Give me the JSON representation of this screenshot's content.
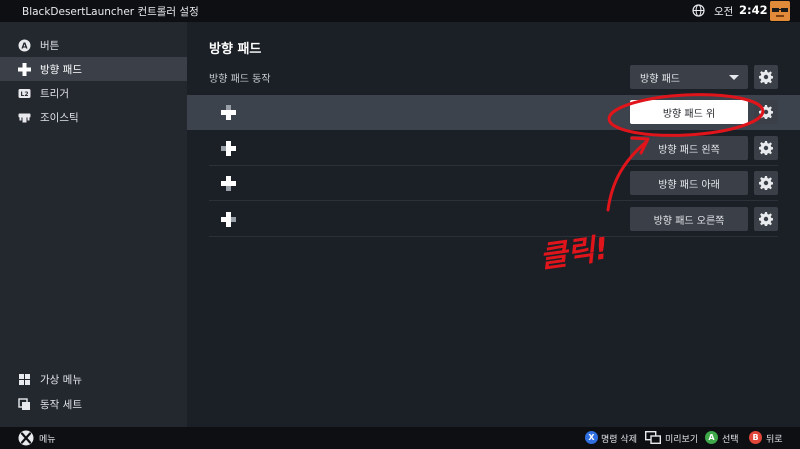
{
  "topbar": {
    "title": "BlackDesertLauncher 컨트롤러 설정",
    "clock_label": "오전",
    "clock_time": "2:42"
  },
  "sidebar": {
    "items": [
      {
        "label": "버튼",
        "icon": "a-button-icon"
      },
      {
        "label": "방향 패드",
        "icon": "dpad-icon"
      },
      {
        "label": "트리거",
        "icon": "trigger-icon"
      },
      {
        "label": "조이스틱",
        "icon": "joystick-icon"
      }
    ],
    "bottom_items": [
      {
        "label": "가상 메뉴",
        "icon": "grid-icon"
      },
      {
        "label": "동작 세트",
        "icon": "action-set-icon"
      }
    ]
  },
  "main": {
    "title": "방향 패드",
    "section_label": "방향 패드 동작",
    "mode_select": "방향 패드",
    "rows": [
      {
        "action": "방향 패드 위",
        "highlighted": true
      },
      {
        "action": "방향 패드 왼쪽",
        "highlighted": false
      },
      {
        "action": "방향 패드 아래",
        "highlighted": false
      },
      {
        "action": "방향 패드 오른쪽",
        "highlighted": false
      }
    ]
  },
  "annotation": {
    "text": "클릭!",
    "color": "#e0141b"
  },
  "bottombar": {
    "menu": "메뉴",
    "delete": "명령 삭제",
    "preview": "미리보기",
    "select": "선택",
    "back": "뒤로",
    "x_glyph": "X",
    "a_glyph": "A",
    "b_glyph": "B"
  },
  "colors": {
    "x_button": "#2f6fe0",
    "a_button": "#3fa84a",
    "b_button": "#e0473a",
    "highlight_row": "#3d434c",
    "sidebar_active": "#3a3f48"
  }
}
